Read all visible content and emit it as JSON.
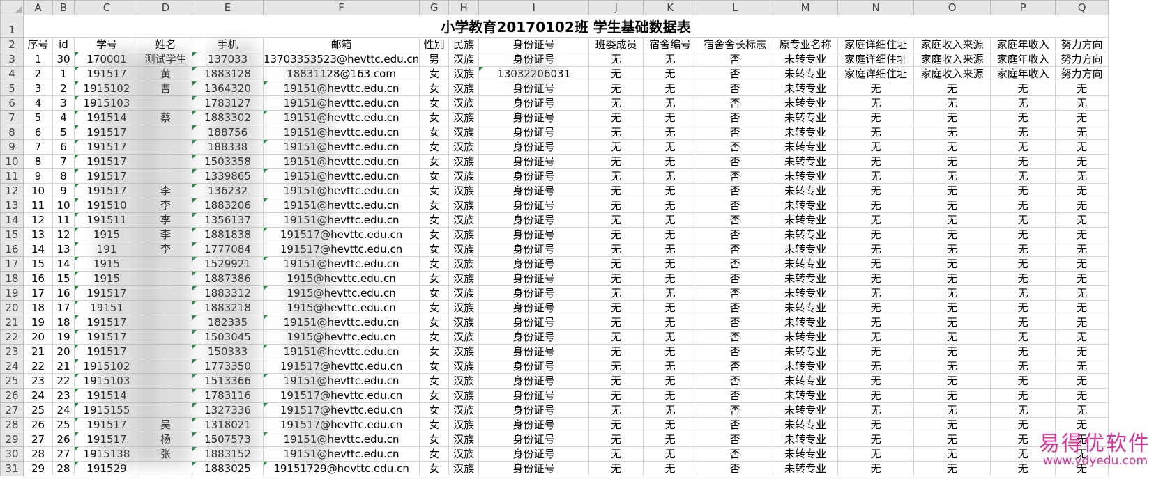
{
  "sheet": {
    "title": "小学教育20170102班 学生基础数据表",
    "column_letters": [
      "A",
      "B",
      "C",
      "D",
      "E",
      "F",
      "G",
      "H",
      "I",
      "J",
      "K",
      "L",
      "M",
      "N",
      "O",
      "P",
      "Q"
    ],
    "headers": [
      "序号",
      "id",
      "学号",
      "姓名",
      "手机",
      "邮箱",
      "性别",
      "民族",
      "身份证号",
      "班委成员",
      "宿舍编号",
      "宿舍舍长标志",
      "原专业名称",
      "家庭详细住址",
      "家庭收入来源",
      "家庭年收入",
      "努力方向"
    ],
    "rows": [
      {
        "n": "3",
        "c": [
          "1",
          "30",
          "170001",
          "测试学生",
          "137033",
          "13703353523@hevttc.edu.cn",
          "男",
          "汉族",
          "身份证号",
          "无",
          "无",
          "否",
          "未转专业",
          "家庭详细住址",
          "家庭收入来源",
          "家庭年收入",
          "努力方向"
        ]
      },
      {
        "n": "4",
        "c": [
          "2",
          "1",
          "191517",
          "黄",
          "1883128",
          "18831128@163.com",
          "女",
          "汉族",
          "13032206031",
          "无",
          "无",
          "否",
          "未转专业",
          "家庭详细住址",
          "家庭收入来源",
          "家庭年收入",
          "努力方向"
        ]
      },
      {
        "n": "5",
        "c": [
          "3",
          "2",
          "1915102",
          "曹",
          "1364320",
          "19151@hevttc.edu.cn",
          "女",
          "汉族",
          "身份证号",
          "无",
          "无",
          "否",
          "未转专业",
          "无",
          "无",
          "无",
          "无"
        ]
      },
      {
        "n": "6",
        "c": [
          "4",
          "3",
          "1915103",
          "",
          "1783127",
          "19151@hevttc.edu.cn",
          "女",
          "汉族",
          "身份证号",
          "无",
          "无",
          "否",
          "未转专业",
          "无",
          "无",
          "无",
          "无"
        ]
      },
      {
        "n": "7",
        "c": [
          "5",
          "4",
          "191514",
          "蔡",
          "1883302",
          "19151@hevttc.edu.cn",
          "女",
          "汉族",
          "身份证号",
          "无",
          "无",
          "否",
          "未转专业",
          "无",
          "无",
          "无",
          "无"
        ]
      },
      {
        "n": "8",
        "c": [
          "6",
          "5",
          "191517",
          "",
          "188756",
          "19151@hevttc.edu.cn",
          "女",
          "汉族",
          "身份证号",
          "无",
          "无",
          "否",
          "未转专业",
          "无",
          "无",
          "无",
          "无"
        ]
      },
      {
        "n": "9",
        "c": [
          "7",
          "6",
          "191517",
          "",
          "188338",
          "19151@hevttc.edu.cn",
          "女",
          "汉族",
          "身份证号",
          "无",
          "无",
          "否",
          "未转专业",
          "无",
          "无",
          "无",
          "无"
        ]
      },
      {
        "n": "10",
        "c": [
          "8",
          "7",
          "191517",
          "",
          "1503358",
          "19151@hevttc.edu.cn",
          "女",
          "汉族",
          "身份证号",
          "无",
          "无",
          "否",
          "未转专业",
          "无",
          "无",
          "无",
          "无"
        ]
      },
      {
        "n": "11",
        "c": [
          "9",
          "8",
          "191517",
          "",
          "1339865",
          "19151@hevttc.edu.cn",
          "女",
          "汉族",
          "身份证号",
          "无",
          "无",
          "否",
          "未转专业",
          "无",
          "无",
          "无",
          "无"
        ]
      },
      {
        "n": "12",
        "c": [
          "10",
          "9",
          "191517",
          "李",
          "136232",
          "19151@hevttc.edu.cn",
          "女",
          "汉族",
          "身份证号",
          "无",
          "无",
          "否",
          "未转专业",
          "无",
          "无",
          "无",
          "无"
        ]
      },
      {
        "n": "13",
        "c": [
          "11",
          "10",
          "191510",
          "李",
          "1883206",
          "19151@hevttc.edu.cn",
          "女",
          "汉族",
          "身份证号",
          "无",
          "无",
          "否",
          "未转专业",
          "无",
          "无",
          "无",
          "无"
        ]
      },
      {
        "n": "14",
        "c": [
          "12",
          "11",
          "191511",
          "李",
          "1356137",
          "19151@hevttc.edu.cn",
          "女",
          "汉族",
          "身份证号",
          "无",
          "无",
          "否",
          "未转专业",
          "无",
          "无",
          "无",
          "无"
        ]
      },
      {
        "n": "15",
        "c": [
          "13",
          "12",
          "1915",
          "李",
          "1881838",
          "191517@hevttc.edu.cn",
          "女",
          "汉族",
          "身份证号",
          "无",
          "无",
          "否",
          "未转专业",
          "无",
          "无",
          "无",
          "无"
        ]
      },
      {
        "n": "16",
        "c": [
          "14",
          "13",
          "191",
          "李",
          "1777084",
          "191517@hevttc.edu.cn",
          "女",
          "汉族",
          "身份证号",
          "无",
          "无",
          "否",
          "未转专业",
          "无",
          "无",
          "无",
          "无"
        ]
      },
      {
        "n": "17",
        "c": [
          "15",
          "14",
          "1915",
          "",
          "1529921",
          "19151@hevttc.edu.cn",
          "女",
          "汉族",
          "身份证号",
          "无",
          "无",
          "否",
          "未转专业",
          "无",
          "无",
          "无",
          "无"
        ]
      },
      {
        "n": "18",
        "c": [
          "16",
          "15",
          "1915",
          "",
          "1887386",
          "1915@hevttc.edu.cn",
          "女",
          "汉族",
          "身份证号",
          "无",
          "无",
          "否",
          "未转专业",
          "无",
          "无",
          "无",
          "无"
        ]
      },
      {
        "n": "19",
        "c": [
          "17",
          "16",
          "191517",
          "",
          "1883312",
          "1915@hevttc.edu.cn",
          "女",
          "汉族",
          "身份证号",
          "无",
          "无",
          "否",
          "未转专业",
          "无",
          "无",
          "无",
          "无"
        ]
      },
      {
        "n": "20",
        "c": [
          "18",
          "17",
          "19151",
          "",
          "1883218",
          "1915@hevttc.edu.cn",
          "女",
          "汉族",
          "身份证号",
          "无",
          "无",
          "否",
          "未转专业",
          "无",
          "无",
          "无",
          "无"
        ]
      },
      {
        "n": "21",
        "c": [
          "19",
          "18",
          "191517",
          "",
          "182335",
          "19151@hevttc.edu.cn",
          "女",
          "汉族",
          "身份证号",
          "无",
          "无",
          "否",
          "未转专业",
          "无",
          "无",
          "无",
          "无"
        ]
      },
      {
        "n": "22",
        "c": [
          "20",
          "19",
          "191517",
          "",
          "1503045",
          "1915@hevttc.edu.cn",
          "女",
          "汉族",
          "身份证号",
          "无",
          "无",
          "否",
          "未转专业",
          "无",
          "无",
          "无",
          "无"
        ]
      },
      {
        "n": "23",
        "c": [
          "21",
          "20",
          "191517",
          "",
          "150333",
          "19151@hevttc.edu.cn",
          "女",
          "汉族",
          "身份证号",
          "无",
          "无",
          "否",
          "未转专业",
          "无",
          "无",
          "无",
          "无"
        ]
      },
      {
        "n": "24",
        "c": [
          "22",
          "21",
          "1915102",
          "",
          "1773350",
          "191517@hevttc.edu.cn",
          "女",
          "汉族",
          "身份证号",
          "无",
          "无",
          "否",
          "未转专业",
          "无",
          "无",
          "无",
          "无"
        ]
      },
      {
        "n": "25",
        "c": [
          "23",
          "22",
          "1915103",
          "",
          "1513366",
          "19151@hevttc.edu.cn",
          "女",
          "汉族",
          "身份证号",
          "无",
          "无",
          "否",
          "未转专业",
          "无",
          "无",
          "无",
          "无"
        ]
      },
      {
        "n": "26",
        "c": [
          "24",
          "23",
          "191514",
          "",
          "1783116",
          "191517@hevttc.edu.cn",
          "女",
          "汉族",
          "身份证号",
          "无",
          "无",
          "否",
          "未转专业",
          "无",
          "无",
          "无",
          "无"
        ]
      },
      {
        "n": "27",
        "c": [
          "25",
          "24",
          "1915155",
          "",
          "1327336",
          "191517@hevttc.edu.cn",
          "女",
          "汉族",
          "身份证号",
          "无",
          "无",
          "否",
          "未转专业",
          "无",
          "无",
          "无",
          "无"
        ]
      },
      {
        "n": "28",
        "c": [
          "26",
          "25",
          "191517",
          "吴",
          "1318021",
          "191517@hevttc.edu.cn",
          "女",
          "汉族",
          "身份证号",
          "无",
          "无",
          "否",
          "未转专业",
          "无",
          "无",
          "无",
          "无"
        ]
      },
      {
        "n": "29",
        "c": [
          "27",
          "26",
          "191517",
          "杨",
          "1507573",
          "19151@hevttc.edu.cn",
          "女",
          "汉族",
          "身份证号",
          "无",
          "无",
          "否",
          "未转专业",
          "无",
          "无",
          "无",
          "无"
        ]
      },
      {
        "n": "30",
        "c": [
          "28",
          "27",
          "1915138",
          "张",
          "1883152",
          "19151@hevttc.edu.cn",
          "女",
          "汉族",
          "身份证号",
          "无",
          "无",
          "否",
          "未转专业",
          "无",
          "无",
          "无",
          "无"
        ]
      },
      {
        "n": "31",
        "c": [
          "29",
          "28",
          "191529",
          "",
          "1883025",
          "19151729@hevttc.edu.cn",
          "女",
          "汉族",
          "身份证号",
          "无",
          "无",
          "否",
          "未转专业",
          "无",
          "无",
          "无",
          "无"
        ]
      }
    ]
  },
  "watermark": {
    "line1": "易得优软件",
    "line2": "www.ydyedu.com",
    "color": "#e0309b"
  },
  "colors": {
    "header_bg": "#e6e6e6",
    "grid": "#d4d4d4",
    "error_triangle": "#1e8a3c"
  }
}
